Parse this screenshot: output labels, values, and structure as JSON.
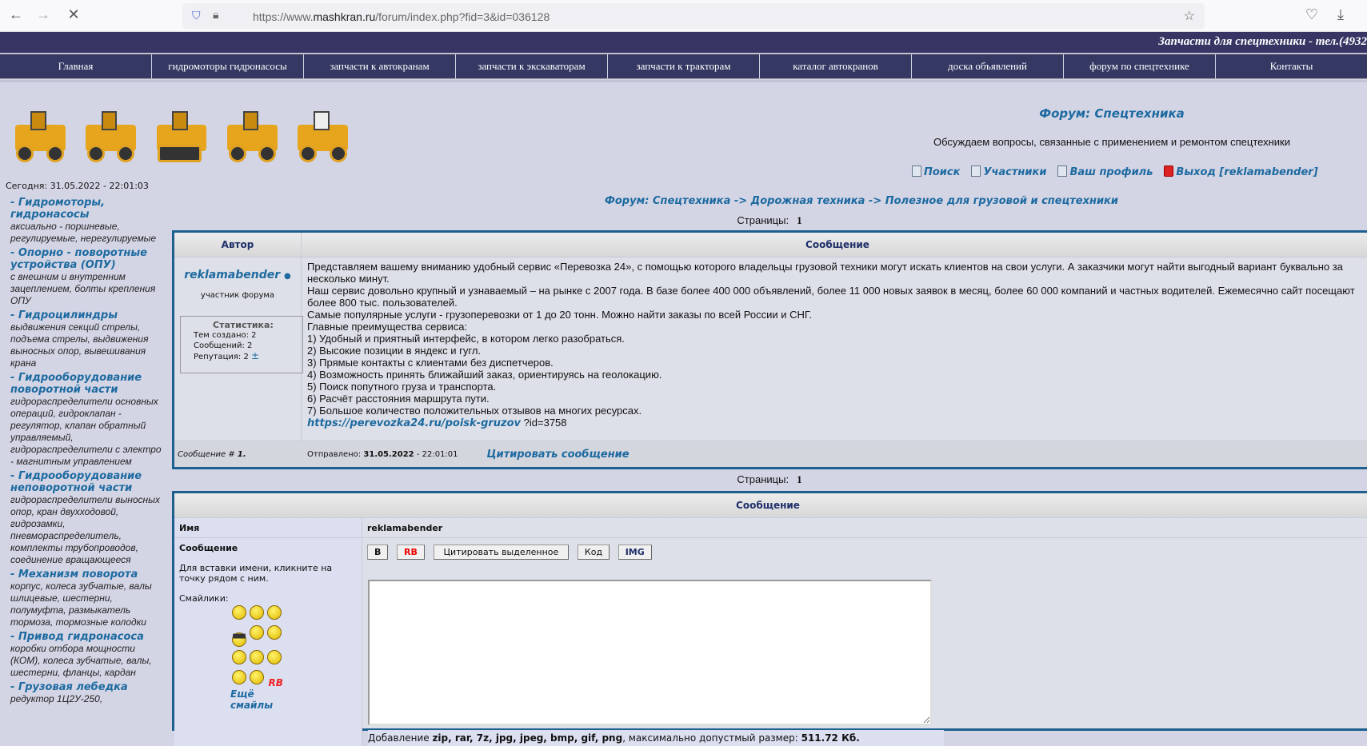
{
  "browser": {
    "url_prefix": "https://www.",
    "url_domain": "mashkran.ru",
    "url_path": "/forum/index.php?fid=3&id=036128"
  },
  "banner": "Запчасти для спецтехники - тел.(4932",
  "nav": [
    "Главная",
    "гидромоторы гидронасосы",
    "запчасти к автокранам",
    "запчасти к экскаваторам",
    "запчасти к тракторам",
    "каталог автокранов",
    "доска объявлений",
    "форум по спецтехнике",
    "Контакты"
  ],
  "header": {
    "forum_title": "Форум: Спецтехника",
    "subtitle": "Обсуждаем вопросы, связанные с применением и ремонтом спецтехники",
    "links": [
      "Поиск",
      "Участники",
      "Ваш профиль",
      "Выход [reklamabender]"
    ]
  },
  "today": "Сегодня: 31.05.2022 - 22:01:03",
  "sidebar": [
    {
      "title": "- Гидромоторы, гидронасосы",
      "desc": "аксиально - поршневые, регулируемые, нерегулируемые"
    },
    {
      "title": "- Опорно - поворотные устройства (ОПУ)",
      "desc": "с внешним и внутренним зацеплением, болты крепления ОПУ"
    },
    {
      "title": "- Гидроцилиндры",
      "desc": "выдвижения секций стрелы, подъема стрелы, выдвижения выносных опор, вывешивания крана"
    },
    {
      "title": "- Гидрооборудование поворотной части",
      "desc": "гидрораспределители основных операций, гидроклапан - регулятор, клапан обратный управляемый, гидрораспределители с электро - магнитным управлением"
    },
    {
      "title": "- Гидрооборудование неповоротной части",
      "desc": "гидрораспределители выносных опор, кран двухходовой, гидрозамки, пневмораспределитель, комплекты трубопроводов, соединение вращающееся"
    },
    {
      "title": "- Механизм поворота",
      "desc": "корпус, колеса зубчатые, валы шлицевые, шестерни, полумуфта, размыкатель тормоза, тормозные колодки"
    },
    {
      "title": "- Привод гидронасоса",
      "desc": "коробки отбора мощности (КОМ), колеса зубчатые, валы, шестерни, фланцы, кардан"
    },
    {
      "title": "- Грузовая лебедка",
      "desc": "редуктор 1Ц2У-250,"
    }
  ],
  "breadcrumb": "Форум: Спецтехника -> Дорожная техника -> Полезное для грузовой и спецтехники",
  "pages_label": "Страницы:",
  "pages_value": "1",
  "post": {
    "col_author": "Автор",
    "col_message": "Сообщение",
    "author": "reklamabender",
    "online_dot": "●",
    "rank": "участник форума",
    "stats_title": "Статистика:",
    "stats": [
      "Тем создано: 2",
      "Сообщений: 2"
    ],
    "reputation": "Репутация: 2",
    "rep_btn": "±",
    "lines": [
      "Представляем вашему вниманию удобный сервис «Перевозка 24», с помощью которого владельцы грузовой техники могут искать клиентов на свои услуги. А заказчики могут найти выгодный вариант буквально за несколько минут.",
      "Наш сервис довольно крупный и узнаваемый – на рынке с 2007 года. В базе более 400 000 объявлений, более 11 000 новых заявок в месяц, более 60 000 компаний и частных водителей. Ежемесячно сайт посещают более 800 тыс. пользователей.",
      "Самые популярные услуги - грузоперевозки от 1 до 20 тонн. Можно найти заказы по всей России и СНГ.",
      "Главные преимущества сервиса:",
      "1) Удобный и приятный интерфейс, в котором легко разобраться.",
      "2) Высокие позиции в яндекс и гугл.",
      "3) Прямые контакты с клиентами без диспетчеров.",
      "4) Возможность принять ближайший заказ, ориентируясь на геолокацию.",
      "5) Поиск попутного груза и транспорта.",
      "6) Расчёт расстояния маршрута пути.",
      "7) Большое количество положительных отзывов на многих ресурсах."
    ],
    "link": "https://perevozka24.ru/poisk-gruzov",
    "link_suffix": " ?id=3758",
    "msg_num_label": "Сообщение #",
    "msg_num": "1.",
    "sent_label": "Отправлено:",
    "sent_date": "31.05.2022",
    "sent_time": " - 22:01:01",
    "quote": "Цитировать сообщение"
  },
  "reply": {
    "header": "Сообщение",
    "name_label": "Имя",
    "name_value": "reklamabender",
    "msg_label": "Сообщение",
    "hint": "Для вставки имени, кликните на точку рядом с ним.",
    "smileys_label": "Смайлики:",
    "rb": "RB",
    "more_smileys": "Ещё смайлы",
    "buttons": [
      "B",
      "RB",
      "Цитировать выделенное",
      "Код",
      "IMG"
    ],
    "attach_prefix": "Добавление ",
    "attach_types": "zip, rar, 7z, jpg, jpeg, bmp, gif, png",
    "attach_mid": ", максимально допустмый размер: ",
    "attach_size": "511.72 Кб."
  },
  "colors": {
    "nav": "#363864",
    "link": "#1d6aa0",
    "bg": "#d3d5e5",
    "border": "#1d5f8f"
  }
}
